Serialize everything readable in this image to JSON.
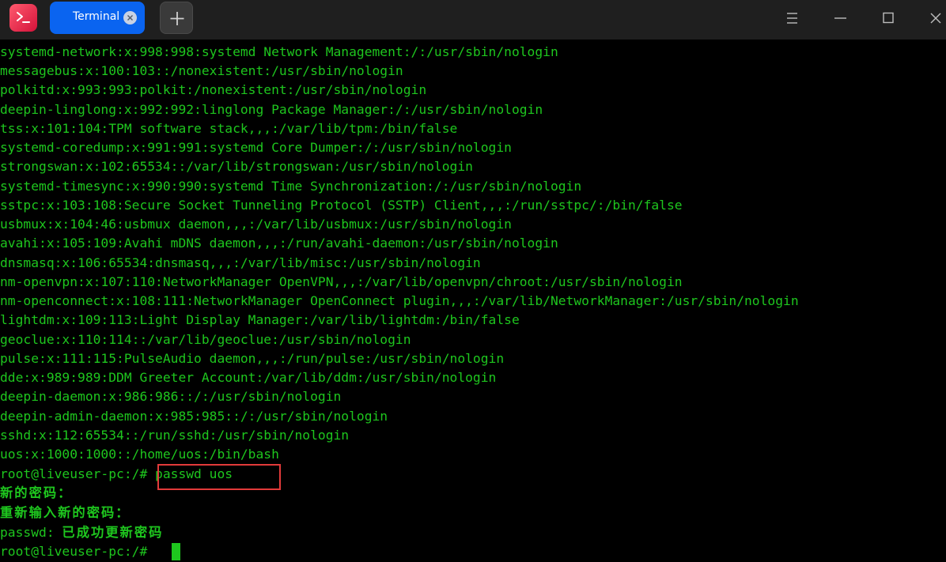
{
  "window": {
    "tab_title": "Terminal",
    "new_tab_symbol": "+",
    "controls": [
      "menu-icon",
      "minimize-icon",
      "maximize-icon",
      "close-icon"
    ],
    "app_icon": "terminal-app-icon"
  },
  "colors": {
    "terminal_bg": "#000000",
    "terminal_text": "#1ec61e",
    "tab_active": "#0a64f0",
    "titlebar": "#1f1f1f",
    "highlight_border": "#e23a3a"
  },
  "terminal": {
    "lines": [
      "systemd-network:x:998:998:systemd Network Management:/:/usr/sbin/nologin",
      "messagebus:x:100:103::/nonexistent:/usr/sbin/nologin",
      "polkitd:x:993:993:polkit:/nonexistent:/usr/sbin/nologin",
      "deepin-linglong:x:992:992:linglong Package Manager:/:/usr/sbin/nologin",
      "tss:x:101:104:TPM software stack,,,:/var/lib/tpm:/bin/false",
      "systemd-coredump:x:991:991:systemd Core Dumper:/:/usr/sbin/nologin",
      "strongswan:x:102:65534::/var/lib/strongswan:/usr/sbin/nologin",
      "systemd-timesync:x:990:990:systemd Time Synchronization:/:/usr/sbin/nologin",
      "sstpc:x:103:108:Secure Socket Tunneling Protocol (SSTP) Client,,,:/run/sstpc/:/bin/false",
      "usbmux:x:104:46:usbmux daemon,,,:/var/lib/usbmux:/usr/sbin/nologin",
      "avahi:x:105:109:Avahi mDNS daemon,,,:/run/avahi-daemon:/usr/sbin/nologin",
      "dnsmasq:x:106:65534:dnsmasq,,,:/var/lib/misc:/usr/sbin/nologin",
      "nm-openvpn:x:107:110:NetworkManager OpenVPN,,,:/var/lib/openvpn/chroot:/usr/sbin/nologin",
      "nm-openconnect:x:108:111:NetworkManager OpenConnect plugin,,,:/var/lib/NetworkManager:/usr/sbin/nologin",
      "lightdm:x:109:113:Light Display Manager:/var/lib/lightdm:/bin/false",
      "geoclue:x:110:114::/var/lib/geoclue:/usr/sbin/nologin",
      "pulse:x:111:115:PulseAudio daemon,,,:/run/pulse:/usr/sbin/nologin",
      "dde:x:989:989:DDM Greeter Account:/var/lib/ddm:/usr/sbin/nologin",
      "deepin-daemon:x:986:986::/:/usr/sbin/nologin",
      "deepin-admin-daemon:x:985:985::/:/usr/sbin/nologin",
      "sshd:x:112:65534::/run/sshd:/usr/sbin/nologin",
      "uos:x:1000:1000::/home/uos:/bin/bash"
    ],
    "prompt_1": "root@liveuser-pc:/# ",
    "command_1": "passwd uos",
    "new_password_prompt": "新的密码：",
    "retype_password_prompt": "重新输入新的密码：",
    "result_prefix": "passwd: ",
    "result_message": "已成功更新密码",
    "prompt_2": "root@liveuser-pc:/# "
  }
}
